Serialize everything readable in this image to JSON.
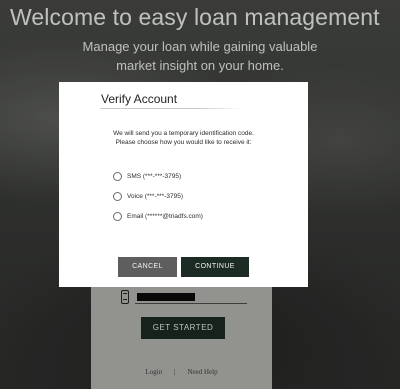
{
  "hero": {
    "title": "Welcome to easy loan management",
    "subtitle_line1": "Manage your loan while gaining valuable",
    "subtitle_line2": "market insight on your home."
  },
  "card": {
    "phone_icon": "phone-icon",
    "phone_value_masked": "",
    "get_started_label": "GET STARTED",
    "links": {
      "login": "Login",
      "separator": "|",
      "need_help": "Need Help"
    }
  },
  "modal": {
    "title": "Verify Account",
    "description_line1": "We will send you a temporary identification code.",
    "description_line2": "Please choose how you would like to receive it:",
    "options": [
      {
        "label": "SMS (***-***-3795)",
        "selected": false
      },
      {
        "label": "Voice (***-***-3795)",
        "selected": false
      },
      {
        "label": "Email (******@triadfs.com)",
        "selected": false
      }
    ],
    "cancel_label": "CANCEL",
    "continue_label": "CONTINUE"
  },
  "colors": {
    "continue_button": "#1c2b23",
    "cancel_button": "#5e5e5e",
    "get_started_button": "#1b2a21",
    "card_background": "#b2b3ae"
  }
}
